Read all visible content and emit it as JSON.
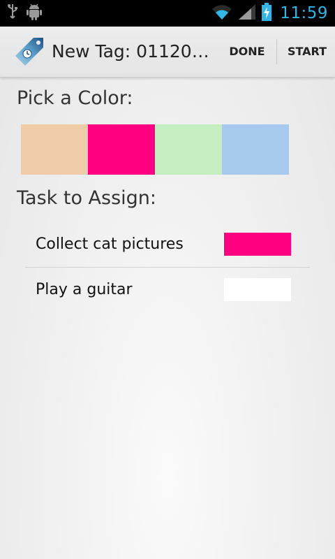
{
  "status_bar": {
    "time": "11:59",
    "icons": [
      "usb-icon",
      "android-debug-icon",
      "wifi-icon",
      "signal-icon",
      "battery-charging-icon"
    ]
  },
  "action_bar": {
    "title": "New Tag: 01120…",
    "done_label": "DONE",
    "start_label": "START",
    "app_icon": "tag-clock-icon"
  },
  "pick_color": {
    "heading": "Pick a Color:",
    "swatches": [
      {
        "name": "peach",
        "color": "#efcba8"
      },
      {
        "name": "pink",
        "color": "#ff0080"
      },
      {
        "name": "mint",
        "color": "#c4eec1"
      },
      {
        "name": "blue",
        "color": "#a8c9ee"
      }
    ]
  },
  "tasks": {
    "heading": "Task to Assign:",
    "items": [
      {
        "label": "Collect cat pictures",
        "color": "#ff0080"
      },
      {
        "label": "Play a guitar",
        "color": "#ffffff"
      }
    ]
  },
  "colors": {
    "accent": "#33b5e5"
  }
}
